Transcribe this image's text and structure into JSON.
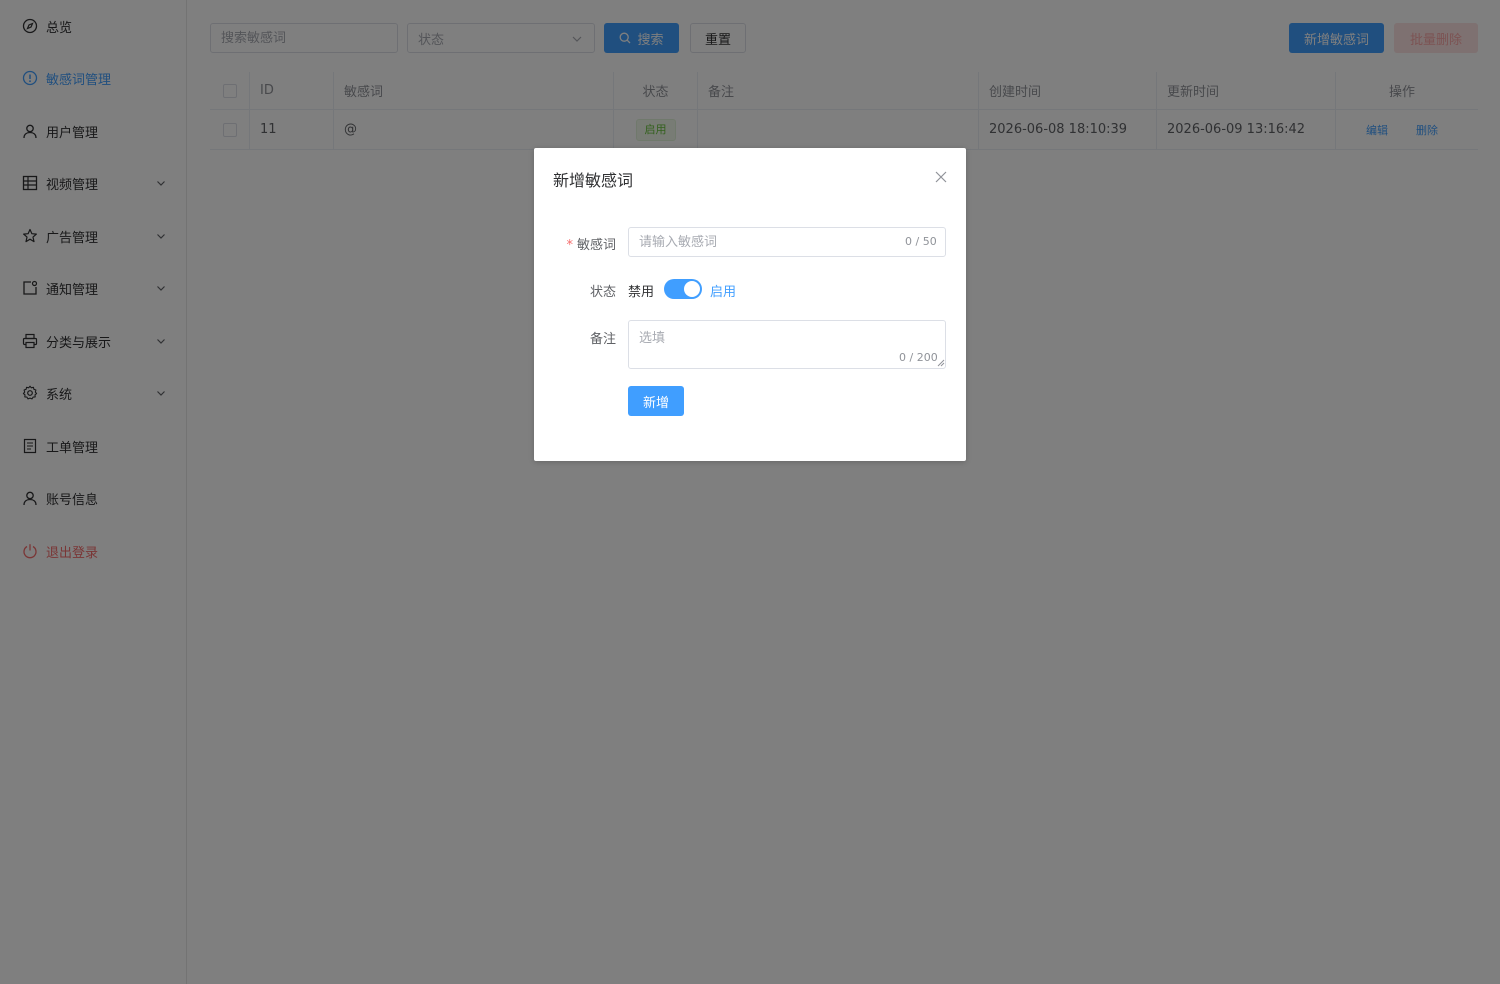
{
  "sidebar": {
    "items": [
      {
        "label": "总览",
        "icon": "compass-icon"
      },
      {
        "label": "敏感词管理",
        "icon": "info-circle-icon",
        "active": true
      },
      {
        "label": "用户管理",
        "icon": "user-icon"
      },
      {
        "label": "视频管理",
        "icon": "grid-icon",
        "expandable": true
      },
      {
        "label": "广告管理",
        "icon": "star-icon",
        "expandable": true
      },
      {
        "label": "通知管理",
        "icon": "notification-icon",
        "expandable": true
      },
      {
        "label": "分类与展示",
        "icon": "printer-icon",
        "expandable": true
      },
      {
        "label": "系统",
        "icon": "gear-icon",
        "expandable": true
      },
      {
        "label": "工单管理",
        "icon": "document-icon"
      },
      {
        "label": "账号信息",
        "icon": "user-icon"
      },
      {
        "label": "退出登录",
        "icon": "power-icon",
        "danger": true
      }
    ]
  },
  "toolbar": {
    "search_placeholder": "搜索敏感词",
    "status_placeholder": "状态",
    "search_label": "搜索",
    "reset_label": "重置",
    "add_label": "新增敏感词",
    "batch_delete_label": "批量删除"
  },
  "table": {
    "columns": [
      "ID",
      "敏感词",
      "状态",
      "备注",
      "创建时间",
      "更新时间",
      "操作"
    ],
    "rows": [
      {
        "id": "11",
        "word": "@",
        "status": "启用",
        "remark": "",
        "created": "2026-06-08 18:10:39",
        "updated": "2026-06-09 13:16:42"
      }
    ],
    "edit_label": "编辑",
    "delete_label": "删除"
  },
  "dialog": {
    "title": "新增敏感词",
    "word_label": "敏感词",
    "word_placeholder": "请输入敏感词",
    "word_counter": "0 / 50",
    "status_label": "状态",
    "switch_off": "禁用",
    "switch_on": "启用",
    "remark_label": "备注",
    "remark_placeholder": "选填",
    "remark_counter": "0 / 200",
    "submit_label": "新增"
  },
  "colors": {
    "primary": "#409eff",
    "danger": "#f56c6c",
    "success": "#67c23a"
  }
}
